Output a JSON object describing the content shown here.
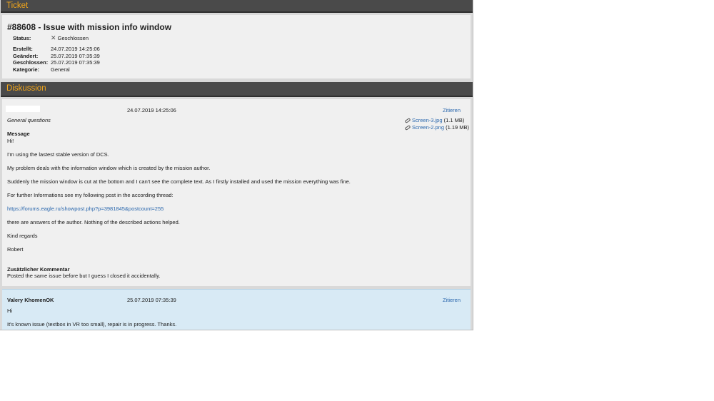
{
  "ticket_section": {
    "title": "Ticket"
  },
  "ticket": {
    "heading": "#88608 - Issue with mission info window",
    "status_label": "Status:",
    "status_value": "Geschlossen",
    "status_icon": "close-icon",
    "meta": [
      {
        "label": "Erstellt:",
        "value": "24.07.2019 14:25:06"
      },
      {
        "label": "Geändert:",
        "value": "25.07.2019 07:35:39"
      },
      {
        "label": "Geschlossen:",
        "value": "25.07.2019 07:35:39"
      },
      {
        "label": "Kategorie:",
        "value": "General"
      }
    ]
  },
  "discussion_section": {
    "title": "Diskussion"
  },
  "post1": {
    "author": "",
    "timestamp": "24.07.2019 14:25:06",
    "quote_label": "Zitieren",
    "category": "General questions",
    "attachments": [
      {
        "name": "Screen-3.jpg",
        "size": "(1.1 MB)"
      },
      {
        "name": "Screen-2.png",
        "size": "(1.19 MB)"
      }
    ],
    "message_label": "Message",
    "lines": [
      "Hi!",
      "I'm using the lastest stable version of DCS.",
      "My problem deals with the information window which is created by the mission author.",
      "Suddenly the mission window is cut at the bottom and I can't see the complete text. As I firstly installed and used the mission everything was fine.",
      "For further Informations see my following post in the according thread:",
      "https://forums.eagle.ru/showpost.php?p=3981845&postcount=255",
      "there are answers of the author. Nothing of the described actions helped.",
      "Kind regards",
      "Robert"
    ],
    "comment_label": "Zusätzlicher Kommentar",
    "comment_text": "Posted the same issue before but I guess I closed it accidentally."
  },
  "post2": {
    "author": "Valery KhomenOK",
    "timestamp": "25.07.2019 07:35:39",
    "quote_label": "Zitieren",
    "lines": [
      "Hi",
      "It's known issue (textbox in VR too small), repair is in progress. Thanks."
    ]
  }
}
